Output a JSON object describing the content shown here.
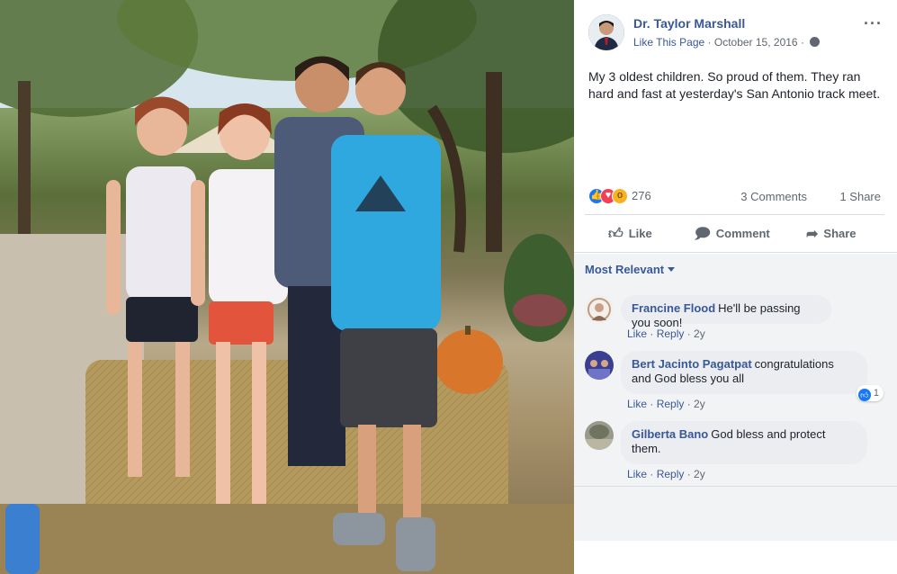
{
  "post": {
    "author": "Dr. Taylor Marshall",
    "like_page": "Like This Page",
    "date": "October 15, 2016",
    "separator": "·",
    "more": "···",
    "caption": "My 3 oldest children. So proud of them. They ran hard and fast at yesterday's San Antonio track meet."
  },
  "reactions": {
    "count": "276",
    "comments": "3 Comments",
    "shares": "1 Share",
    "icons": [
      "like",
      "love",
      "wow"
    ]
  },
  "actions": {
    "like": "Like",
    "comment": "Comment",
    "share": "Share"
  },
  "sort": {
    "label": "Most Relevant"
  },
  "comments": [
    {
      "name": "Francine Flood",
      "text": "He'll be passing you soon!",
      "like": "Like",
      "reply": "Reply",
      "time": "2y"
    },
    {
      "name": "Bert Jacinto Pagatpat",
      "text": "congratulations and God bless you all",
      "like": "Like",
      "reply": "Reply",
      "time": "2y",
      "reaction_count": "1"
    },
    {
      "name": "Gilberta Bano",
      "text": "God bless and protect them.",
      "like": "Like",
      "reply": "Reply",
      "time": "2y"
    }
  ],
  "colors": {
    "link": "#385898",
    "like_blue": "#1877f2",
    "love_red": "#f33e58",
    "wow_yellow": "#f7b125",
    "comment_bg": "#f2f3f5"
  }
}
